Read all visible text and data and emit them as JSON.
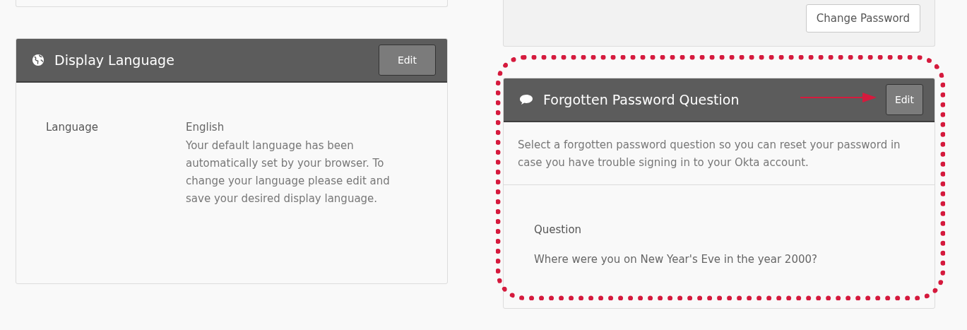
{
  "top_card": {
    "button": "Change Password"
  },
  "display_language": {
    "title": "Display Language",
    "edit_button": "Edit",
    "label": "Language",
    "value": "English",
    "note": "Your default language has been automatically set by your browser. To change your language please edit and save your desired display language."
  },
  "forgotten_password_question": {
    "title": "Forgotten Password Question",
    "edit_button": "Edit",
    "description": "Select a forgotten password question so you can reset your password in case you have trouble signing in to your Okta account.",
    "label": "Question",
    "value": "Where were you on New Year's Eve in the year 2000?"
  }
}
